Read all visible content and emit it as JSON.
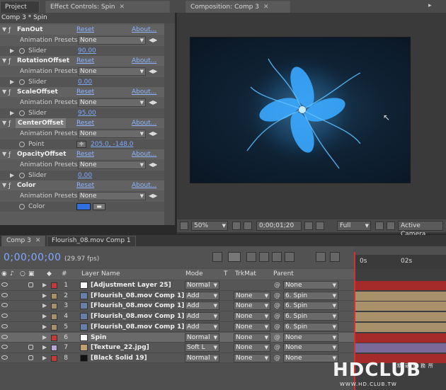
{
  "tabs": {
    "project": "Project",
    "effect_controls": "Effect Controls: Spin",
    "composition": "Composition: Comp 3"
  },
  "effect_controls": {
    "header": "Comp 3 * Spin",
    "reset_label": "Reset",
    "about_label": "About...",
    "anim_presets_label": "Animation Presets:",
    "preset_value": "None",
    "effects": [
      {
        "name": "FanOut",
        "param": "Slider",
        "value": "90.00"
      },
      {
        "name": "RotationOffset",
        "param": "Slider",
        "value": "0.00"
      },
      {
        "name": "ScaleOffset",
        "param": "Slider",
        "value": "95.00"
      },
      {
        "name": "CenterOffset",
        "param": "Point",
        "value": "205.0, -148.0"
      },
      {
        "name": "OpacityOffset",
        "param": "Slider",
        "value": "0.00"
      },
      {
        "name": "Color",
        "param": "Color",
        "value": ""
      }
    ],
    "color_swatch": "#2f6fe0"
  },
  "comp_toolbar": {
    "zoom": "50%",
    "timecode": "0;00;01;20",
    "resolution": "Full",
    "camera": "Active Camera"
  },
  "timeline": {
    "tabs": [
      "Comp 3",
      "Flourish_08.mov Comp 1"
    ],
    "timecode": "0;00;00;00",
    "fps": "(29.97 fps)",
    "headers": {
      "hash": "#",
      "layer_name": "Layer Name",
      "mode": "Mode",
      "t": "T",
      "trkmat": "TrkMat",
      "parent": "Parent"
    },
    "ruler": {
      "start": "0s",
      "mark": "02s"
    },
    "layers": [
      {
        "idx": "1",
        "name": "[Adjustment Layer 25]",
        "mode": "Normal",
        "trkmat": "",
        "parent": "None",
        "label": "#c23a3a",
        "src": "#ffffff"
      },
      {
        "idx": "2",
        "name": "[Flourish_08.mov Comp 1]",
        "mode": "Add",
        "trkmat": "None",
        "parent": "6. Spin",
        "label": "#a8906a",
        "src": "#6a7fa8"
      },
      {
        "idx": "3",
        "name": "[Flourish_08.mov Comp 1]",
        "mode": "Add",
        "trkmat": "None",
        "parent": "6. Spin",
        "label": "#a8906a",
        "src": "#6a7fa8"
      },
      {
        "idx": "4",
        "name": "[Flourish_08.mov Comp 1]",
        "mode": "Add",
        "trkmat": "None",
        "parent": "6. Spin",
        "label": "#a8906a",
        "src": "#6a7fa8"
      },
      {
        "idx": "5",
        "name": "[Flourish_08.mov Comp 1]",
        "mode": "Add",
        "trkmat": "None",
        "parent": "6. Spin",
        "label": "#a8906a",
        "src": "#6a7fa8"
      },
      {
        "idx": "6",
        "name": "Spin",
        "mode": "Normal",
        "trkmat": "None",
        "parent": "None",
        "label": "#c23a3a",
        "src": "#ffffff"
      },
      {
        "idx": "7",
        "name": "[Texture_22.jpg]",
        "mode": "Soft L",
        "trkmat": "None",
        "parent": "None",
        "label": "#b7a6d6",
        "src": "#c0a070"
      },
      {
        "idx": "8",
        "name": "[Black Solid 19]",
        "mode": "Normal",
        "trkmat": "None",
        "parent": "None",
        "label": "#c23a3a",
        "src": "#111111"
      }
    ]
  },
  "watermark": {
    "logo": "HDCLUB",
    "tagline": "精研事務所",
    "url": "WWW.HD.CLUB.TW"
  }
}
